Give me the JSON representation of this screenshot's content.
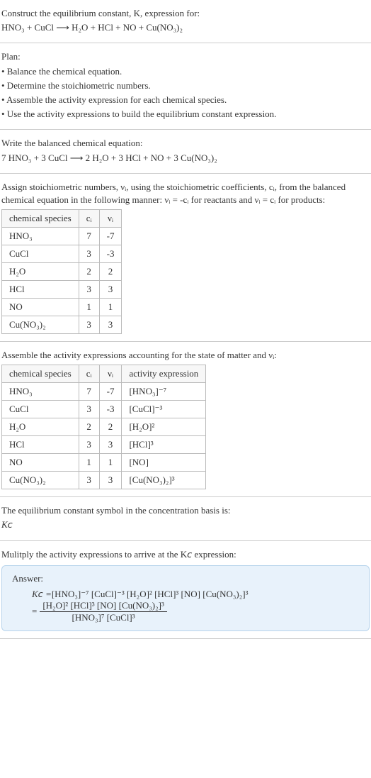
{
  "s1": {
    "l1": "Construct the equilibrium constant, K, expression for:",
    "l2": "HNO₃ + CuCl ⟶ H₂O + HCl + NO + Cu(NO₃)₂"
  },
  "s2": {
    "h": "Plan:",
    "b1": "• Balance the chemical equation.",
    "b2": "• Determine the stoichiometric numbers.",
    "b3": "• Assemble the activity expression for each chemical species.",
    "b4": "• Use the activity expressions to build the equilibrium constant expression."
  },
  "s3": {
    "l1": "Write the balanced chemical equation:",
    "l2": "7 HNO₃ + 3 CuCl ⟶ 2 H₂O + 3 HCl + NO + 3 Cu(NO₃)₂"
  },
  "s4": {
    "p": "Assign stoichiometric numbers, νᵢ, using the stoichiometric coefficients, cᵢ, from the balanced chemical equation in the following manner: νᵢ = -cᵢ for reactants and νᵢ = cᵢ for products:",
    "th1": "chemical species",
    "th2": "cᵢ",
    "th3": "νᵢ",
    "rows": [
      {
        "sp": "HNO₃",
        "c": "7",
        "v": "-7"
      },
      {
        "sp": "CuCl",
        "c": "3",
        "v": "-3"
      },
      {
        "sp": "H₂O",
        "c": "2",
        "v": "2"
      },
      {
        "sp": "HCl",
        "c": "3",
        "v": "3"
      },
      {
        "sp": "NO",
        "c": "1",
        "v": "1"
      },
      {
        "sp": "Cu(NO₃)₂",
        "c": "3",
        "v": "3"
      }
    ]
  },
  "s5": {
    "p": "Assemble the activity expressions accounting for the state of matter and νᵢ:",
    "th1": "chemical species",
    "th2": "cᵢ",
    "th3": "νᵢ",
    "th4": "activity expression",
    "rows": [
      {
        "sp": "HNO₃",
        "c": "7",
        "v": "-7",
        "a": "[HNO₃]⁻⁷"
      },
      {
        "sp": "CuCl",
        "c": "3",
        "v": "-3",
        "a": "[CuCl]⁻³"
      },
      {
        "sp": "H₂O",
        "c": "2",
        "v": "2",
        "a": "[H₂O]²"
      },
      {
        "sp": "HCl",
        "c": "3",
        "v": "3",
        "a": "[HCl]³"
      },
      {
        "sp": "NO",
        "c": "1",
        "v": "1",
        "a": "[NO]"
      },
      {
        "sp": "Cu(NO₃)₂",
        "c": "3",
        "v": "3",
        "a": "[Cu(NO₃)₂]³"
      }
    ]
  },
  "s6": {
    "l1": "The equilibrium constant symbol in the concentration basis is:",
    "l2": "K𝘤"
  },
  "s7": {
    "p": "Mulitply the activity expressions to arrive at the K𝘤 expression:"
  },
  "ans": {
    "label": "Answer:",
    "line1_lhs": "K𝘤 = ",
    "line1_rhs": "[HNO₃]⁻⁷ [CuCl]⁻³ [H₂O]² [HCl]³ [NO] [Cu(NO₃)₂]³",
    "line2_lhs": "= ",
    "num": "[H₂O]² [HCl]³ [NO] [Cu(NO₃)₂]³",
    "den": "[HNO₃]⁷ [CuCl]³"
  },
  "chart_data": {
    "type": "table",
    "tables": [
      {
        "title": "Stoichiometric numbers",
        "columns": [
          "chemical species",
          "cᵢ",
          "νᵢ"
        ],
        "rows": [
          [
            "HNO₃",
            7,
            -7
          ],
          [
            "CuCl",
            3,
            -3
          ],
          [
            "H₂O",
            2,
            2
          ],
          [
            "HCl",
            3,
            3
          ],
          [
            "NO",
            1,
            1
          ],
          [
            "Cu(NO₃)₂",
            3,
            3
          ]
        ]
      },
      {
        "title": "Activity expressions",
        "columns": [
          "chemical species",
          "cᵢ",
          "νᵢ",
          "activity expression"
        ],
        "rows": [
          [
            "HNO₃",
            7,
            -7,
            "[HNO₃]⁻⁷"
          ],
          [
            "CuCl",
            3,
            -3,
            "[CuCl]⁻³"
          ],
          [
            "H₂O",
            2,
            2,
            "[H₂O]²"
          ],
          [
            "HCl",
            3,
            3,
            "[HCl]³"
          ],
          [
            "NO",
            1,
            1,
            "[NO]"
          ],
          [
            "Cu(NO₃)₂",
            3,
            3,
            "[Cu(NO₃)₂]³"
          ]
        ]
      }
    ]
  }
}
